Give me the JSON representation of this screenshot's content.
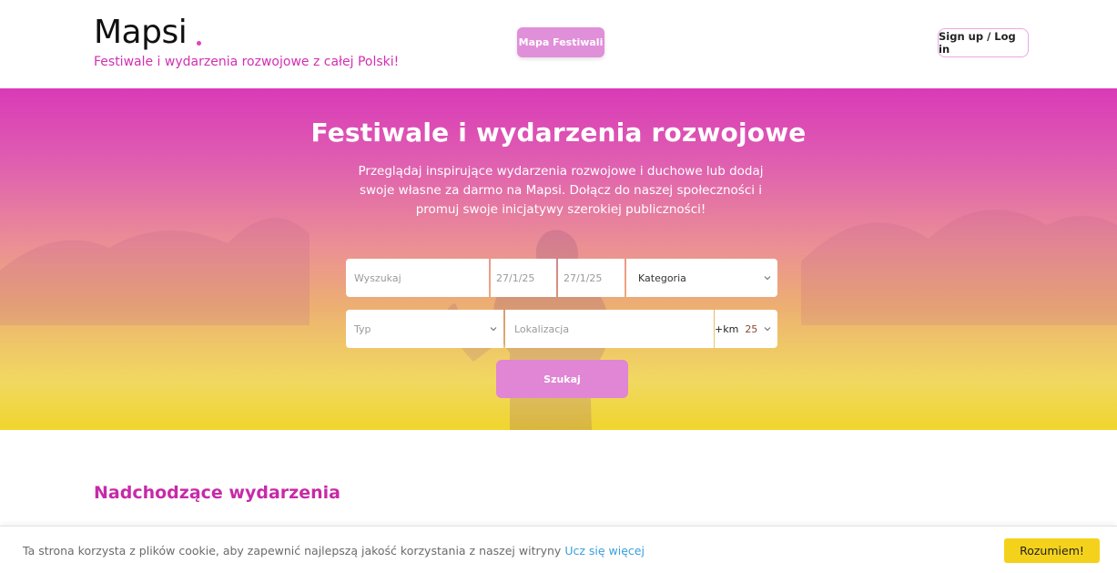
{
  "header": {
    "logo_text": "Mapsi",
    "tagline": "Festiwale i wydarzenia rozwojowe z całej Polski!",
    "map_button": "Mapa Festiwali",
    "auth_button": "Sign up / Log in"
  },
  "hero": {
    "title": "Festiwale i wydarzenia rozwojowe",
    "subtitle": "Przeglądaj inspirujące wydarzenia rozwojowe i duchowe lub dodaj swoje własne za darmo na Mapsi. Dołącz do naszej społeczności i promuj swoje inicjatywy szerokiej publiczności!"
  },
  "search_form": {
    "search_placeholder": "Wyszukaj",
    "date_from": "27/1/25",
    "date_to": "27/1/25",
    "category_selected": "Kategoria",
    "type_selected": "Typ",
    "location_placeholder": "Lokalizacja",
    "radius_label": "+km",
    "radius_value": "25",
    "submit_label": "Szukaj"
  },
  "upcoming": {
    "title": "Nadchodzące wydarzenia"
  },
  "cookie_bar": {
    "text": "Ta strona korzysta z plików cookie, aby zapewnić najlepszą jakość korzystania z naszej witryny",
    "link": "Ucz się więcej",
    "accept_button": "Rozumiem!"
  },
  "colors": {
    "brand_pink": "#d22fb3",
    "button_pink": "#e086d4",
    "cookie_yellow": "#f4d21b"
  },
  "icons": [
    "chevron-down-icon"
  ]
}
